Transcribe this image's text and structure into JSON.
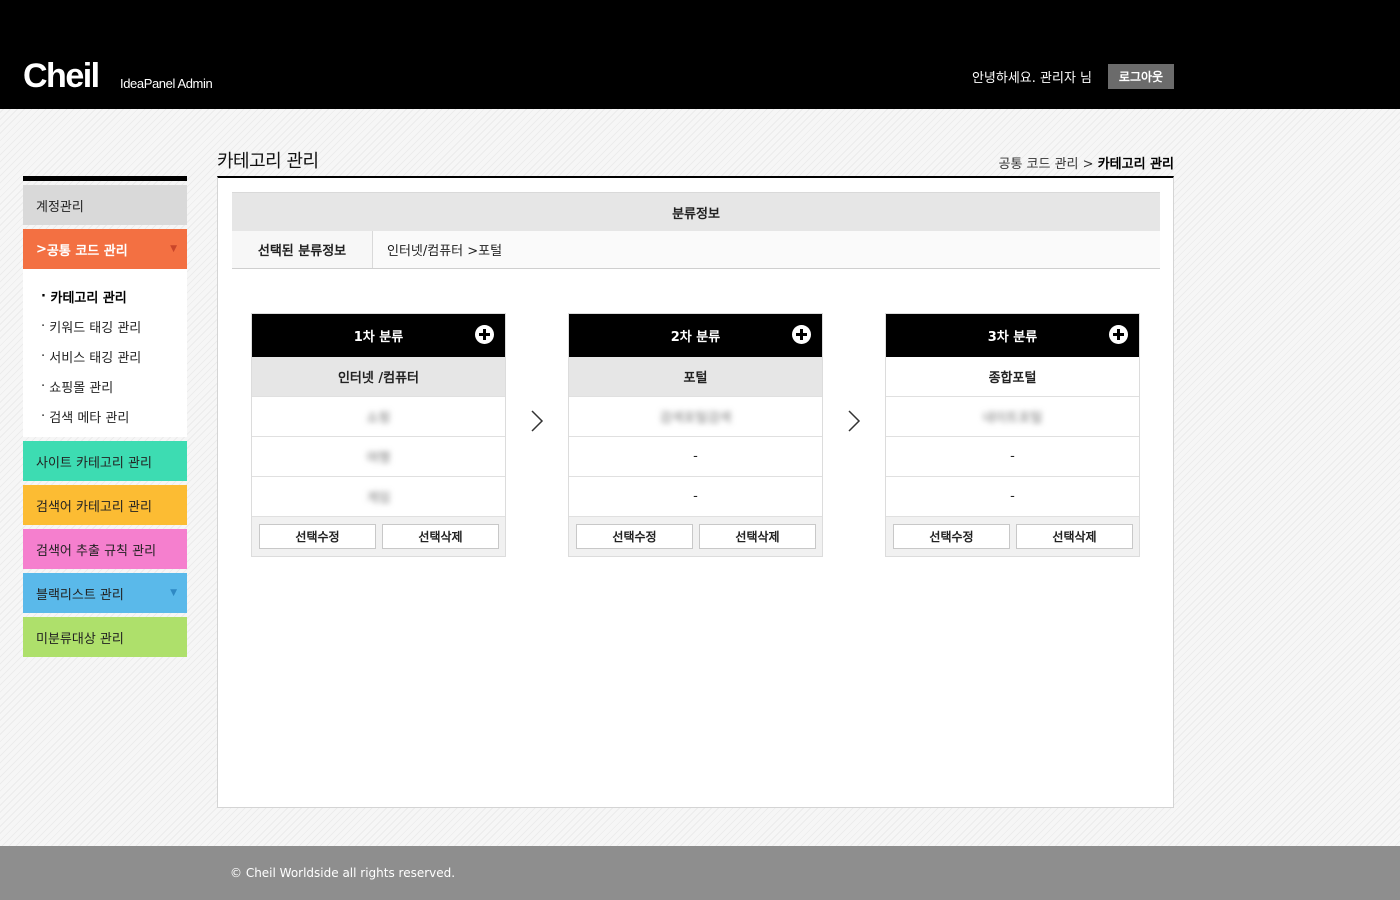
{
  "header": {
    "logo": "Cheil",
    "logo_sub": "IdeaPanel Admin",
    "greeting": "안녕하세요. 관리자 님",
    "logout_label": "로그아웃"
  },
  "sidebar": {
    "menu": [
      {
        "label": "계정관리",
        "color": "#d9d9d9"
      },
      {
        "label": "공통 코드 관리",
        "color": "#f37042",
        "active": true
      },
      {
        "label": "사이트 카테고리 관리",
        "color": "#3ddcb2"
      },
      {
        "label": "검색어 카테고리 관리",
        "color": "#fcbc33"
      },
      {
        "label": "검색어 추출 규칙 관리",
        "color": "#f57fce"
      },
      {
        "label": "블랙리스트 관리",
        "color": "#5ab9ea"
      },
      {
        "label": "미분류대상 관리",
        "color": "#aee06b"
      }
    ],
    "active_prefix": ">",
    "submenu": [
      {
        "label": "카테고리 관리",
        "current": true
      },
      {
        "label": "키워드 태깅 관리"
      },
      {
        "label": "서비스 태깅 관리"
      },
      {
        "label": "쇼핑몰 관리"
      },
      {
        "label": "검색 메타 관리"
      }
    ],
    "submenu_bullet": "·"
  },
  "page": {
    "title": "카테고리 관리",
    "breadcrumb_parent": "공통 코드 관리",
    "breadcrumb_sep": ">",
    "breadcrumb_current": "카테고리 관리"
  },
  "info": {
    "header": "분류정보",
    "selected_label": "선택된 분류정보",
    "selected_value": "인터넷/컴퓨터 >포털"
  },
  "columns": [
    {
      "title": "1차 분류",
      "rows": [
        "인터넷 /컴퓨터",
        "쇼핑",
        "여행",
        "게임"
      ],
      "edit_label": "선택수정",
      "delete_label": "선택삭제"
    },
    {
      "title": "2차 분류",
      "rows": [
        "포털",
        "검색포털검색",
        "-",
        "-"
      ],
      "edit_label": "선택수정",
      "delete_label": "선택삭제"
    },
    {
      "title": "3차 분류",
      "rows": [
        "종합포털",
        "네이트포털",
        "-",
        "-"
      ],
      "edit_label": "선택수정",
      "delete_label": "선택삭제"
    }
  ],
  "icons": {
    "add": "plus-circle-icon",
    "next": "chevron-right-icon",
    "expand": "triangle-down-icon"
  },
  "footer": {
    "copyright": "© Cheil Worldside all rights reserved."
  }
}
